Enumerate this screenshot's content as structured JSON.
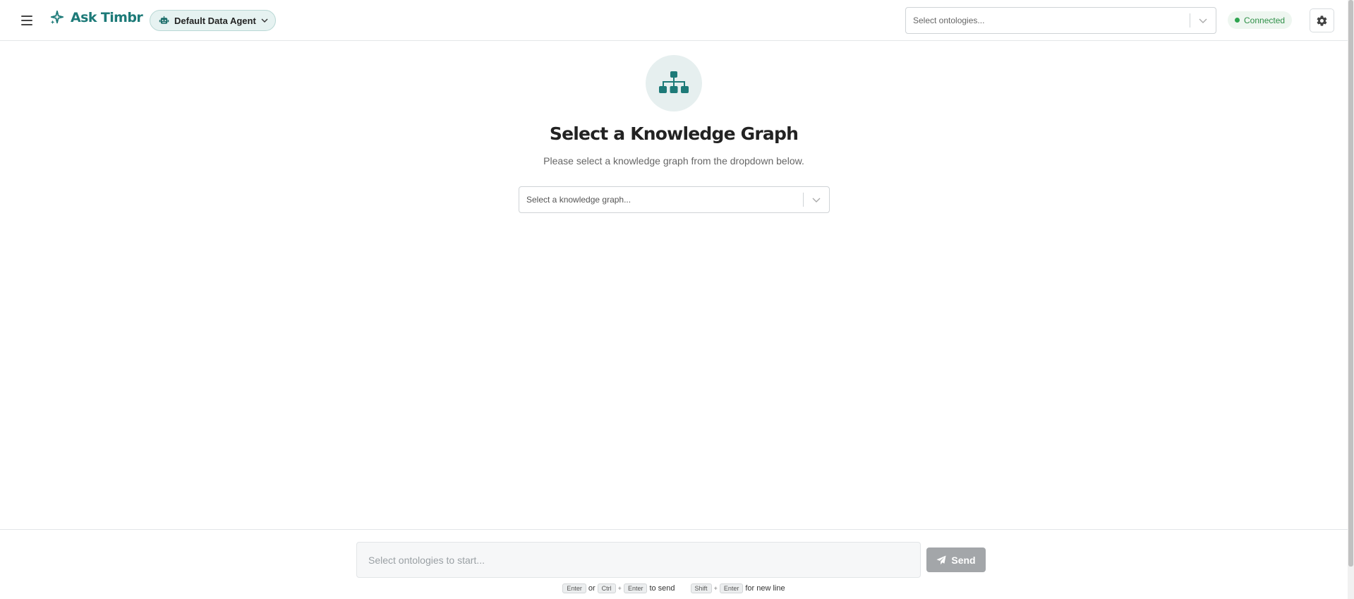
{
  "header": {
    "brand": "Ask Timbr",
    "agent_label": "Default Data Agent",
    "ontologies_placeholder": "Select ontologies...",
    "status": "Connected"
  },
  "main": {
    "title": "Select a Knowledge Graph",
    "subtitle": "Please select a knowledge graph from the dropdown below.",
    "kg_placeholder": "Select a knowledge graph..."
  },
  "footer": {
    "input_placeholder": "Select ontologies to start...",
    "send_label": "Send",
    "hints": {
      "enter": "Enter",
      "or": "or",
      "ctrl": "Ctrl",
      "plus": "+",
      "to_send": "to send",
      "shift": "Shift",
      "new_line": "for new line"
    }
  },
  "colors": {
    "accent": "#1d7a78",
    "connected": "#2ea44f",
    "send_disabled": "#a3a6a9"
  },
  "icons": [
    "menu-icon",
    "sparkle-icon",
    "robot-icon",
    "chevron-down-icon",
    "gear-icon",
    "sitemap-icon",
    "paper-plane-icon"
  ]
}
